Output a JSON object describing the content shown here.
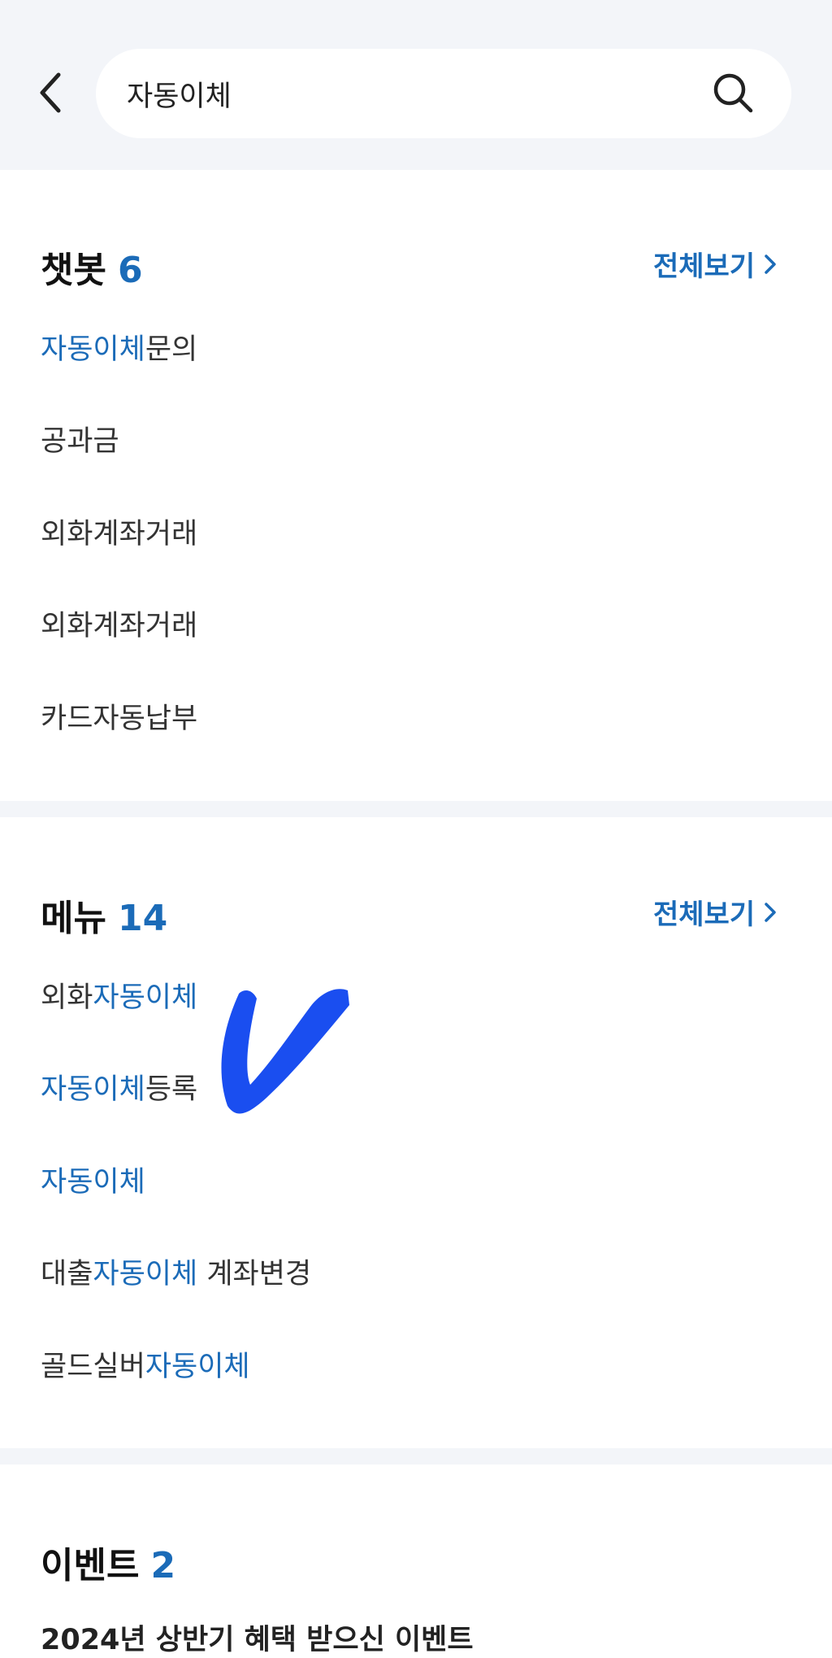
{
  "search": {
    "query": "자동이체"
  },
  "chatbot": {
    "title": "챗봇",
    "count": "6",
    "view_all": "전체보기",
    "items": [
      {
        "pre": "",
        "hl": "자동이체",
        "post": "문의"
      },
      {
        "pre": "공과금",
        "hl": "",
        "post": ""
      },
      {
        "pre": "외화계좌거래",
        "hl": "",
        "post": ""
      },
      {
        "pre": "외화계좌거래",
        "hl": "",
        "post": ""
      },
      {
        "pre": "카드자동납부",
        "hl": "",
        "post": ""
      }
    ]
  },
  "menu": {
    "title": "메뉴",
    "count": "14",
    "view_all": "전체보기",
    "items": [
      {
        "pre": "외화",
        "hl": "자동이체",
        "post": ""
      },
      {
        "pre": "",
        "hl": "자동이체",
        "post": "등록"
      },
      {
        "pre": "",
        "hl": "자동이체",
        "post": ""
      },
      {
        "pre": "대출",
        "hl": "자동이체",
        "post": " 계좌변경"
      },
      {
        "pre": "골드실버",
        "hl": "자동이체",
        "post": ""
      }
    ]
  },
  "event": {
    "title": "이벤트",
    "count": "2",
    "first_item": "2024년 상반기 혜택 받으신 이벤트"
  },
  "annotation": {
    "icon": "hand-drawn-checkmark-icon",
    "color": "#1a4ef0"
  },
  "colors": {
    "accent": "#1b6bb8",
    "header_bg": "#f3f5f9"
  }
}
